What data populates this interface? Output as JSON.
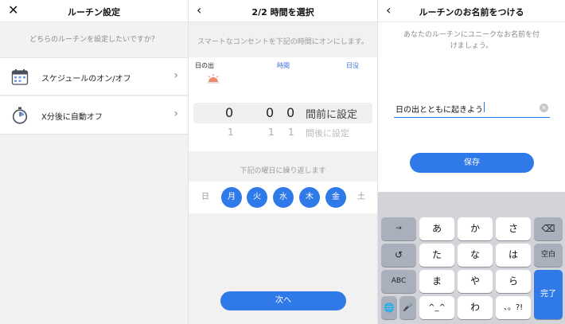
{
  "panel1": {
    "title": "ルーチン設定",
    "close_icon": "close-icon",
    "prompt": "どちらのルーチンを設定したいですか？",
    "options": [
      {
        "label": "スケジュールのオン/オフ",
        "icon": "calendar-icon"
      },
      {
        "label": "X分後に自動オフ",
        "icon": "stopwatch-icon"
      }
    ]
  },
  "panel2": {
    "title": "2/2 時間を選択",
    "back_icon": "back-icon",
    "prompt": "スマートなコンセントを下記の時間にオンにします。",
    "modes": [
      "日の出",
      "時間",
      "日没"
    ],
    "picker": {
      "selected": [
        "0",
        "0",
        "0"
      ],
      "selected_label": "間前に設定",
      "next": [
        "1",
        "1",
        "1"
      ],
      "next_label": "間後に設定"
    },
    "repeat_label": "下記の曜日に繰り返します",
    "days": [
      {
        "label": "日",
        "active": false
      },
      {
        "label": "月",
        "active": true
      },
      {
        "label": "火",
        "active": true
      },
      {
        "label": "水",
        "active": true
      },
      {
        "label": "木",
        "active": true
      },
      {
        "label": "金",
        "active": true
      },
      {
        "label": "土",
        "active": false
      }
    ],
    "next_button": "次へ"
  },
  "panel3": {
    "title": "ルーチンのお名前をつける",
    "back_icon": "back-icon",
    "prompt": "あなたのルーチンにユニークなお名前を付けましょう。",
    "name_value": "日の出とともに起きよう",
    "save_button": "保存"
  },
  "keyboard": {
    "row1": [
      "→",
      "あ",
      "か",
      "さ",
      "⌫"
    ],
    "row2": [
      "↺",
      "た",
      "な",
      "は",
      "空白"
    ],
    "row3": [
      "ABC",
      "ま",
      "や",
      "ら"
    ],
    "row4": [
      "🌐",
      "🎤",
      "^_^",
      "わ",
      "、。?!"
    ],
    "done": "完了"
  },
  "colors": {
    "accent": "#2f7ae8",
    "background": "#f2f2f2",
    "keyboard_bg": "#d2d4da"
  }
}
